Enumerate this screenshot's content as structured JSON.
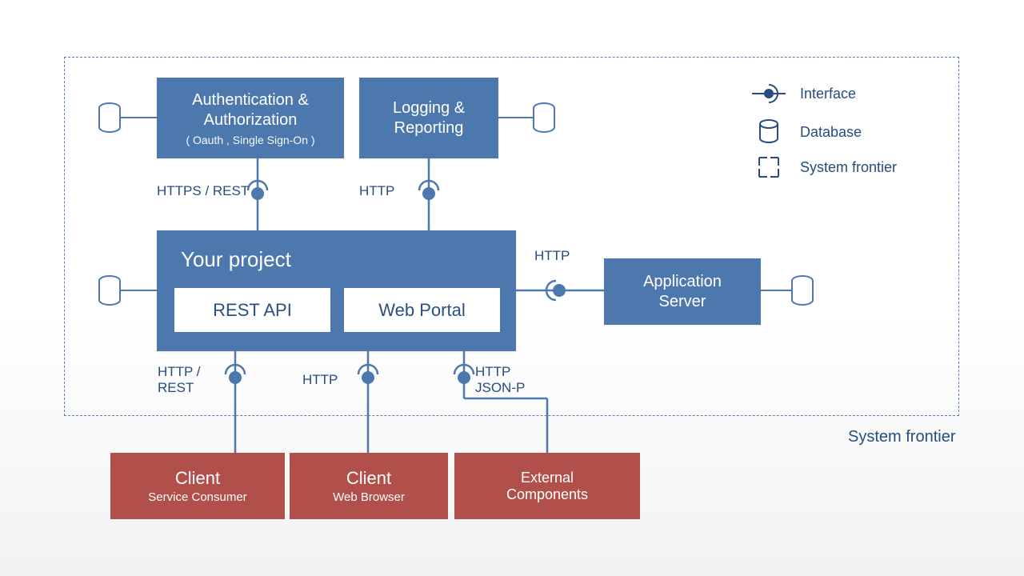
{
  "colors": {
    "blue": "#4d78ad",
    "red": "#b14f4a",
    "ink": "#274c80"
  },
  "frontier_caption": "System frontier",
  "boxes": {
    "auth": {
      "title": "Authentication &\nAuthorization",
      "sub": "( Oauth , Single Sign-On )"
    },
    "log": {
      "title": "Logging &\nReporting"
    },
    "proj": {
      "title": "Your project"
    },
    "rest": {
      "label": "REST  API"
    },
    "portal": {
      "label": "Web Portal"
    },
    "app": {
      "title": "Application\nServer"
    },
    "c1": {
      "title": "Client",
      "sub": "Service Consumer"
    },
    "c2": {
      "title": "Client",
      "sub": "Web Browser"
    },
    "c3": {
      "title": "External\nComponents"
    }
  },
  "labels": {
    "auth_down": "HTTPS / REST",
    "log_down": "HTTP",
    "proj_right": "HTTP",
    "c1_up": "HTTP /\nREST",
    "c2_up": "HTTP",
    "c3_up": "HTTP\nJSON-P"
  },
  "legend": {
    "interface": "Interface",
    "database": "Database",
    "frontier": "System frontier"
  }
}
